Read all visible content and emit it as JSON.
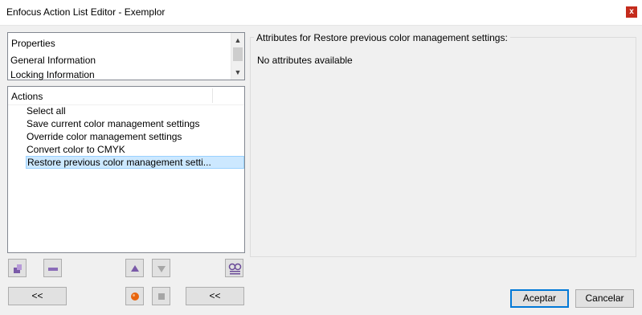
{
  "window": {
    "title": "Enfocus Action List Editor - Exemplor",
    "close_label": "x"
  },
  "properties": {
    "header": "Properties",
    "items": [
      "General Information",
      "Locking Information"
    ]
  },
  "actions": {
    "header": "Actions",
    "items": [
      "Select all",
      "Save current color management settings",
      "Override color management settings",
      "Convert color to CMYK",
      "Restore previous color management setti..."
    ],
    "selected_index": 4
  },
  "attributes": {
    "group_title": "Attributes for Restore previous color management settings:",
    "message": "No attributes available"
  },
  "toolbar": {
    "icons": [
      "add-action-icon",
      "remove-action-icon",
      "move-up-icon",
      "move-down-icon",
      "glasses-icon",
      "record-icon",
      "stop-icon"
    ],
    "collapse_left_label": "<<",
    "collapse_right_label": "<<"
  },
  "buttons": {
    "ok": "Aceptar",
    "cancel": "Cancelar"
  },
  "colors": {
    "selection": "#cce8ff",
    "close": "#c42b1c",
    "record": "#e8650e"
  }
}
